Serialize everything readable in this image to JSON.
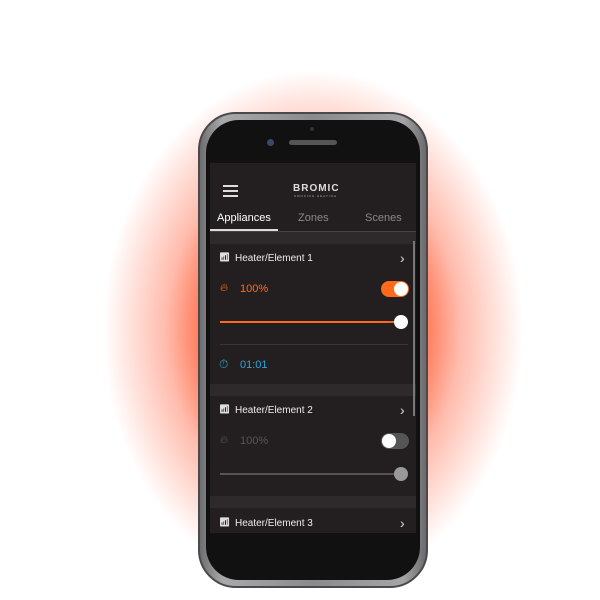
{
  "colors": {
    "accent": "#ff6a1a",
    "timer": "#2aa8d8",
    "background": "#231f20"
  },
  "header": {
    "menu_icon": "hamburger-icon",
    "logo": "BROMIC",
    "logo_sub": "SMOKING HEATING"
  },
  "tabs": [
    {
      "label": "Appliances",
      "active": true
    },
    {
      "label": "Zones"
    },
    {
      "label": "Scenes"
    }
  ],
  "appliances": [
    {
      "name": "Heater/Element 1",
      "power": "100%",
      "on": true,
      "level": 100,
      "timer": "01:01"
    },
    {
      "name": "Heater/Element 2",
      "power": "100%",
      "on": false,
      "level": 100
    },
    {
      "name": "Heater/Element 3"
    }
  ]
}
